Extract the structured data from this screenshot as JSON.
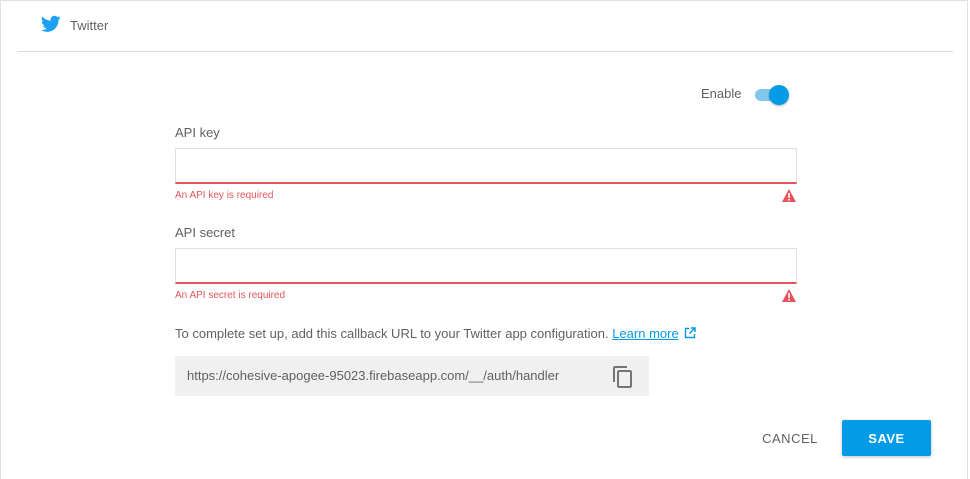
{
  "header": {
    "title": "Twitter",
    "icon": "twitter-icon",
    "brand_color": "#1da1f2"
  },
  "enable": {
    "label": "Enable",
    "on": true
  },
  "fields": {
    "api_key": {
      "label": "API key",
      "value": "",
      "error": "An API key is required"
    },
    "api_secret": {
      "label": "API secret",
      "value": "",
      "error": "An API secret is required"
    }
  },
  "callback": {
    "text": "To complete set up, add this callback URL to your Twitter app configuration.",
    "link_label": "Learn more",
    "url": "https://cohesive-apogee-95023.firebaseapp.com/__/auth/handler"
  },
  "actions": {
    "cancel_label": "CANCEL",
    "save_label": "SAVE"
  },
  "colors": {
    "accent": "#039be5",
    "error": "#e5545d"
  }
}
